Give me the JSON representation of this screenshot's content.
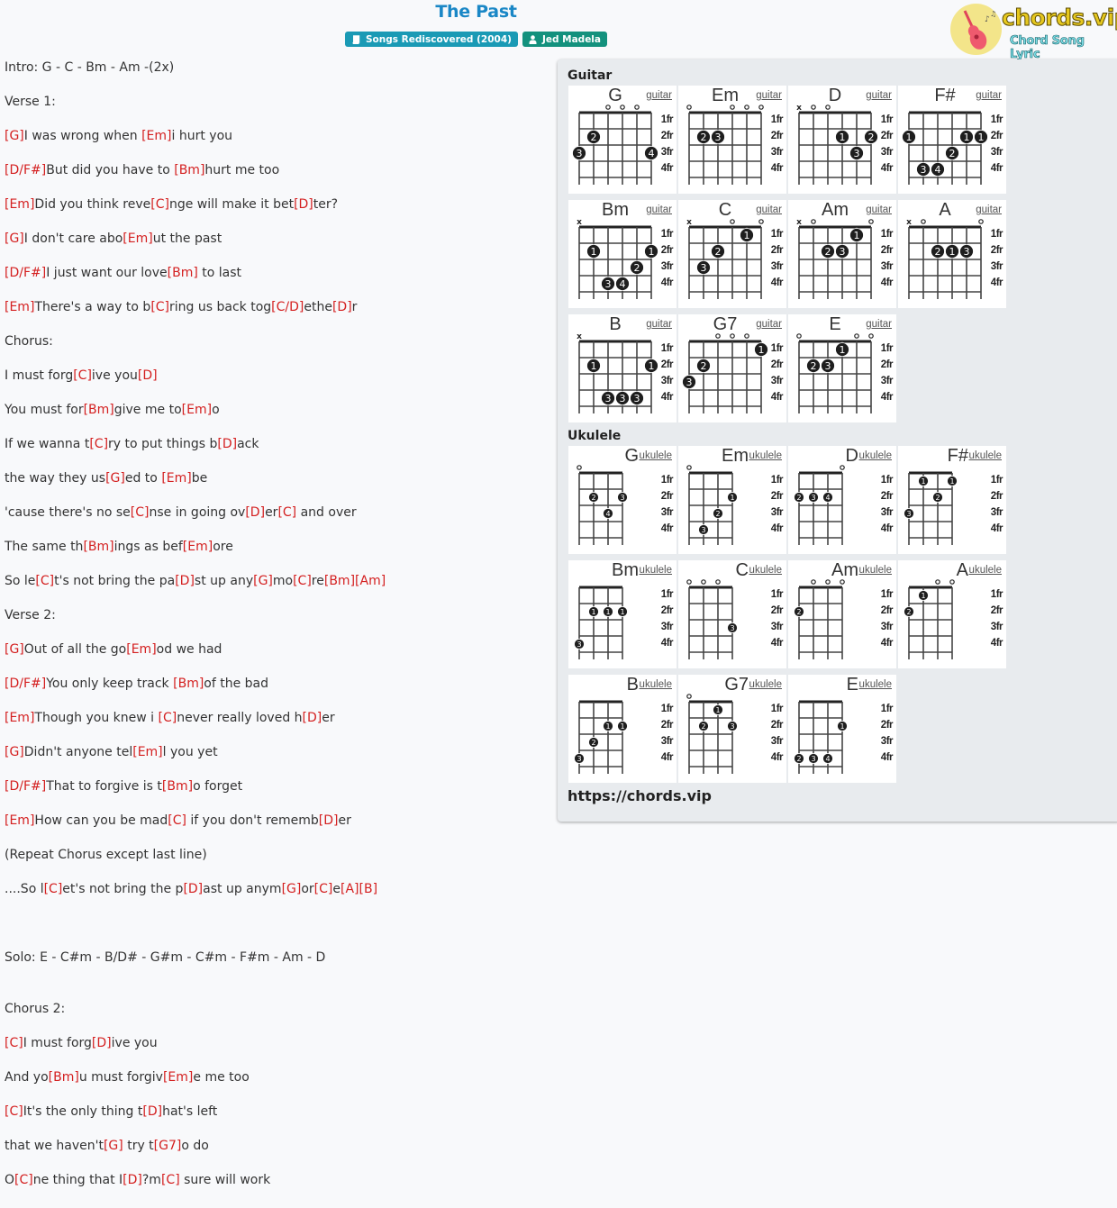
{
  "song": {
    "title": "The Past",
    "album_badge": "Songs Rediscovered (2004)",
    "artist_badge": "Jed Madela"
  },
  "logo": {
    "name": "chords.vip",
    "tagline": "Chord Song Lyric"
  },
  "lyrics": [
    [
      {
        "t": "Intro: G - C - Bm - Am -(2x)"
      }
    ],
    [
      {
        "t": "Verse 1:"
      }
    ],
    [
      {
        "c": "[G]"
      },
      {
        "t": "I was wrong when "
      },
      {
        "c": "[Em]"
      },
      {
        "t": "i hurt you"
      }
    ],
    [
      {
        "c": "[D/F#]"
      },
      {
        "t": "But did you have to "
      },
      {
        "c": "[Bm]"
      },
      {
        "t": "hurt me too"
      }
    ],
    [
      {
        "c": "[Em]"
      },
      {
        "t": "Did you think reve"
      },
      {
        "c": "[C]"
      },
      {
        "t": "nge will make it bet"
      },
      {
        "c": "[D]"
      },
      {
        "t": "ter?"
      }
    ],
    [
      {
        "c": "[G]"
      },
      {
        "t": "I don't care abo"
      },
      {
        "c": "[Em]"
      },
      {
        "t": "ut the past"
      }
    ],
    [
      {
        "c": "[D/F#]"
      },
      {
        "t": "I just want our love"
      },
      {
        "c": "[Bm]"
      },
      {
        "t": " to last"
      }
    ],
    [
      {
        "c": "[Em]"
      },
      {
        "t": "There's a way to b"
      },
      {
        "c": "[C]"
      },
      {
        "t": "ring us back tog"
      },
      {
        "c": "[C/D]"
      },
      {
        "t": "ethe"
      },
      {
        "c": "[D]"
      },
      {
        "t": "r"
      }
    ],
    [
      {
        "t": "Chorus:"
      }
    ],
    [
      {
        "t": "I must forg"
      },
      {
        "c": "[C]"
      },
      {
        "t": "ive you"
      },
      {
        "c": "[D]"
      }
    ],
    [
      {
        "t": "You must for"
      },
      {
        "c": "[Bm]"
      },
      {
        "t": "give me to"
      },
      {
        "c": "[Em]"
      },
      {
        "t": "o"
      }
    ],
    [
      {
        "t": "If we wanna t"
      },
      {
        "c": "[C]"
      },
      {
        "t": "ry to put things b"
      },
      {
        "c": "[D]"
      },
      {
        "t": "ack"
      }
    ],
    [
      {
        "t": "the way they us"
      },
      {
        "c": "[G]"
      },
      {
        "t": "ed to "
      },
      {
        "c": "[Em]"
      },
      {
        "t": "be"
      }
    ],
    [
      {
        "t": "'cause there's no se"
      },
      {
        "c": "[C]"
      },
      {
        "t": "nse in going ov"
      },
      {
        "c": "[D]"
      },
      {
        "t": "er"
      },
      {
        "c": "[C]"
      },
      {
        "t": " and over"
      }
    ],
    [
      {
        "t": "The same th"
      },
      {
        "c": "[Bm]"
      },
      {
        "t": "ings as bef"
      },
      {
        "c": "[Em]"
      },
      {
        "t": "ore"
      }
    ],
    [
      {
        "t": "So le"
      },
      {
        "c": "[C]"
      },
      {
        "t": "t's not bring the pa"
      },
      {
        "c": "[D]"
      },
      {
        "t": "st up any"
      },
      {
        "c": "[G]"
      },
      {
        "t": "mo"
      },
      {
        "c": "[C]"
      },
      {
        "t": "re"
      },
      {
        "c": "[Bm]"
      },
      {
        "c": "[Am]"
      }
    ],
    [
      {
        "t": "Verse 2:"
      }
    ],
    [
      {
        "c": "[G]"
      },
      {
        "t": "Out of all the go"
      },
      {
        "c": "[Em]"
      },
      {
        "t": "od we had"
      }
    ],
    [
      {
        "c": "[D/F#]"
      },
      {
        "t": "You only keep track "
      },
      {
        "c": "[Bm]"
      },
      {
        "t": "of the bad"
      }
    ],
    [
      {
        "c": "[Em]"
      },
      {
        "t": "Though you knew i "
      },
      {
        "c": "[C]"
      },
      {
        "t": "never really loved h"
      },
      {
        "c": "[D]"
      },
      {
        "t": "er"
      }
    ],
    [
      {
        "c": "[G]"
      },
      {
        "t": "Didn't anyone tel"
      },
      {
        "c": "[Em]"
      },
      {
        "t": "l you yet"
      }
    ],
    [
      {
        "c": "[D/F#]"
      },
      {
        "t": "That to forgive is t"
      },
      {
        "c": "[Bm]"
      },
      {
        "t": "o forget"
      }
    ],
    [
      {
        "c": "[Em]"
      },
      {
        "t": "How can you be mad"
      },
      {
        "c": "[C]"
      },
      {
        "t": " if you don't rememb"
      },
      {
        "c": "[D]"
      },
      {
        "t": "er"
      }
    ],
    [
      {
        "t": "(Repeat Chorus except last line)"
      }
    ],
    [
      {
        "t": "....So l"
      },
      {
        "c": "[C]"
      },
      {
        "t": "et's not bring the p"
      },
      {
        "c": "[D]"
      },
      {
        "t": "ast up anym"
      },
      {
        "c": "[G]"
      },
      {
        "t": "or"
      },
      {
        "c": "[C]"
      },
      {
        "t": "e"
      },
      {
        "c": "[A]"
      },
      {
        "c": "[B]"
      }
    ],
    [],
    [
      {
        "t": "Solo: E - C#m - B/D# - G#m - C#m - F#m - Am - D"
      }
    ],
    [],
    [
      {
        "t": "Chorus 2:"
      }
    ],
    [
      {
        "c": "[C]"
      },
      {
        "t": "I must forg"
      },
      {
        "c": "[D]"
      },
      {
        "t": "ive you"
      }
    ],
    [
      {
        "t": "And yo"
      },
      {
        "c": "[Bm]"
      },
      {
        "t": "u must forgiv"
      },
      {
        "c": "[Em]"
      },
      {
        "t": "e me too"
      }
    ],
    [
      {
        "c": "[C]"
      },
      {
        "t": "It's the only thing t"
      },
      {
        "c": "[D]"
      },
      {
        "t": "hat's left"
      }
    ],
    [
      {
        "t": "that we haven't"
      },
      {
        "c": "[G]"
      },
      {
        "t": " try t"
      },
      {
        "c": "[G7]"
      },
      {
        "t": "o do"
      }
    ],
    [
      {
        "t": "O"
      },
      {
        "c": "[C]"
      },
      {
        "t": "ne thing that I"
      },
      {
        "c": "[D]"
      },
      {
        "t": "?m"
      },
      {
        "c": "[C]"
      },
      {
        "t": " sure will work"
      }
    ]
  ],
  "panel": {
    "guitar_label": "Guitar",
    "ukulele_label": "Ukulele",
    "guitar_link": "guitar",
    "ukulele_link": "ukulele",
    "fret_labels": [
      "1fr",
      "2fr",
      "3fr",
      "4fr"
    ],
    "site_url": "https://chords.vip",
    "guitar_chords": [
      {
        "name": "G",
        "open": [
          6,
          0,
          0,
          0,
          0,
          0
        ],
        "mute": [],
        "openStr": [
          3,
          4,
          5
        ],
        "dots": [
          [
            1,
            3,
            "3"
          ],
          [
            2,
            2,
            "2"
          ],
          [
            6,
            3,
            "4"
          ]
        ]
      },
      {
        "name": "Em",
        "openStr": [
          1,
          4,
          5,
          6
        ],
        "mute": [],
        "dots": [
          [
            2,
            2,
            "2"
          ],
          [
            3,
            2,
            "3"
          ]
        ]
      },
      {
        "name": "D",
        "openStr": [
          2,
          3
        ],
        "mute": [
          1
        ],
        "dots": [
          [
            4,
            2,
            "1"
          ],
          [
            6,
            2,
            "2"
          ],
          [
            5,
            3,
            "3"
          ]
        ]
      },
      {
        "name": "F#",
        "openStr": [],
        "mute": [],
        "dots": [
          [
            1,
            2,
            "1"
          ],
          [
            5,
            2,
            "1"
          ],
          [
            6,
            2,
            "1"
          ],
          [
            4,
            3,
            "2"
          ],
          [
            2,
            4,
            "3"
          ],
          [
            3,
            4,
            "4"
          ]
        ]
      },
      {
        "name": "Bm",
        "openStr": [],
        "mute": [
          1
        ],
        "dots": [
          [
            2,
            2,
            "1"
          ],
          [
            6,
            2,
            "1"
          ],
          [
            5,
            3,
            "2"
          ],
          [
            3,
            4,
            "3"
          ],
          [
            4,
            4,
            "4"
          ]
        ]
      },
      {
        "name": "C",
        "openStr": [
          4,
          6
        ],
        "mute": [
          1
        ],
        "dots": [
          [
            5,
            1,
            "1"
          ],
          [
            3,
            2,
            "2"
          ],
          [
            2,
            3,
            "3"
          ]
        ]
      },
      {
        "name": "Am",
        "openStr": [
          2,
          6
        ],
        "mute": [
          1
        ],
        "dots": [
          [
            5,
            1,
            "1"
          ],
          [
            3,
            2,
            "2"
          ],
          [
            4,
            2,
            "3"
          ]
        ]
      },
      {
        "name": "A",
        "openStr": [
          2,
          6
        ],
        "mute": [
          1
        ],
        "dots": [
          [
            3,
            2,
            "2"
          ],
          [
            4,
            2,
            "1"
          ],
          [
            5,
            2,
            "3"
          ]
        ]
      },
      {
        "name": "B",
        "openStr": [],
        "mute": [
          1
        ],
        "dots": [
          [
            2,
            2,
            "1"
          ],
          [
            6,
            2,
            "1"
          ],
          [
            3,
            4,
            "3"
          ],
          [
            4,
            4,
            "3"
          ],
          [
            5,
            4,
            "3"
          ]
        ]
      },
      {
        "name": "G7",
        "openStr": [
          3,
          4,
          5
        ],
        "mute": [],
        "dots": [
          [
            6,
            1,
            "1"
          ],
          [
            2,
            2,
            "2"
          ],
          [
            1,
            3,
            "3"
          ]
        ]
      },
      {
        "name": "E",
        "openStr": [
          1,
          5,
          6
        ],
        "mute": [],
        "dots": [
          [
            4,
            1,
            "1"
          ],
          [
            2,
            2,
            "2"
          ],
          [
            3,
            2,
            "3"
          ]
        ]
      }
    ],
    "ukulele_chords": [
      {
        "name": "G",
        "openStr": [
          1
        ],
        "dots": [
          [
            2,
            2,
            "2"
          ],
          [
            4,
            2,
            "3"
          ],
          [
            3,
            3,
            "4"
          ]
        ]
      },
      {
        "name": "Em",
        "openStr": [
          1
        ],
        "dots": [
          [
            4,
            2,
            "1"
          ],
          [
            3,
            3,
            "2"
          ],
          [
            2,
            4,
            "3"
          ]
        ]
      },
      {
        "name": "D",
        "openStr": [
          4
        ],
        "dots": [
          [
            1,
            2,
            "2"
          ],
          [
            2,
            2,
            "3"
          ],
          [
            3,
            2,
            "4"
          ]
        ]
      },
      {
        "name": "F#",
        "openStr": [],
        "dots": [
          [
            2,
            1,
            "1"
          ],
          [
            4,
            1,
            "1"
          ],
          [
            3,
            2,
            "2"
          ],
          [
            1,
            3,
            "3"
          ]
        ]
      },
      {
        "name": "Bm",
        "openStr": [],
        "dots": [
          [
            2,
            2,
            "1"
          ],
          [
            3,
            2,
            "1"
          ],
          [
            4,
            2,
            "1"
          ],
          [
            1,
            4,
            "3"
          ]
        ]
      },
      {
        "name": "C",
        "openStr": [
          1,
          2,
          3
        ],
        "dots": [
          [
            4,
            3,
            "3"
          ]
        ]
      },
      {
        "name": "Am",
        "openStr": [
          2,
          3,
          4
        ],
        "dots": [
          [
            1,
            2,
            "2"
          ]
        ]
      },
      {
        "name": "A",
        "openStr": [
          3,
          4
        ],
        "dots": [
          [
            2,
            1,
            "1"
          ],
          [
            1,
            2,
            "2"
          ]
        ]
      },
      {
        "name": "B",
        "openStr": [],
        "dots": [
          [
            3,
            2,
            "1"
          ],
          [
            4,
            2,
            "1"
          ],
          [
            2,
            3,
            "2"
          ],
          [
            1,
            4,
            "3"
          ]
        ]
      },
      {
        "name": "G7",
        "openStr": [
          1
        ],
        "dots": [
          [
            3,
            1,
            "1"
          ],
          [
            2,
            2,
            "2"
          ],
          [
            4,
            2,
            "3"
          ]
        ]
      },
      {
        "name": "E",
        "openStr": [],
        "dots": [
          [
            4,
            2,
            "1"
          ],
          [
            1,
            4,
            "2"
          ],
          [
            2,
            4,
            "3"
          ],
          [
            3,
            4,
            "4"
          ]
        ]
      }
    ]
  }
}
